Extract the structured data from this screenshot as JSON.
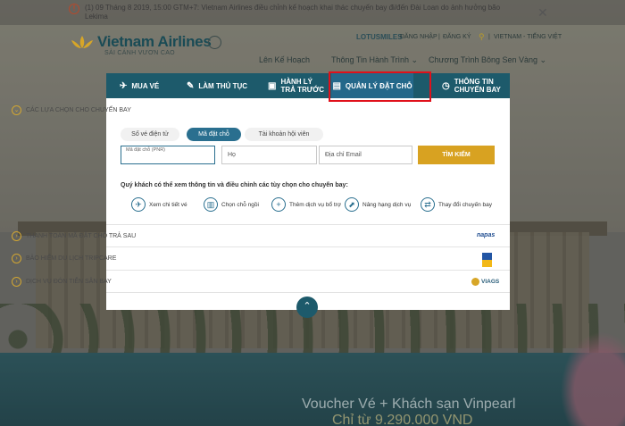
{
  "notice": {
    "text": "(1) 09 Tháng 8 2019, 15:00 GTM+7: Vietnam Airlines điều chỉnh kế hoạch khai thác chuyến bay đi/đến Đài Loan do ảnh hưởng bão Lekima",
    "close": "✕"
  },
  "header": {
    "logo": "Vietnam Airlines",
    "tagline": "SẢI CÁNH VƯƠN CAO",
    "lotusmiles": "LOTUSMILES",
    "login": "ĐĂNG NHẬP",
    "separator": "|",
    "register": "ĐĂNG KÝ",
    "search_icon": "⚲",
    "language": "VIETNAM - TIẾNG VIỆT",
    "nav": [
      "Lên Kế Hoạch",
      "Thông Tin Hành Trình ⌄",
      "Chương Trình Bông Sen Vàng ⌄"
    ]
  },
  "tabs": [
    {
      "icon": "✈",
      "icon_name": "plane-icon",
      "label": "MUA VÉ"
    },
    {
      "icon": "✎",
      "icon_name": "ticket-icon",
      "label": "LÀM THỦ TỤC"
    },
    {
      "icon": "▣",
      "icon_name": "luggage-icon",
      "label_1": "HÀNH LÝ",
      "label_2": "TRẢ TRƯỚC"
    },
    {
      "icon": "▤",
      "icon_name": "booking-icon",
      "label": "QUẢN LÝ ĐẶT CHỖ"
    },
    {
      "icon": "◷",
      "icon_name": "clock-icon",
      "label_1": "THÔNG TIN",
      "label_2": "CHUYẾN BAY"
    }
  ],
  "options_section": {
    "title": "CÁC LỰA CHỌN CHO CHUYẾN BAY",
    "subtabs": [
      "Số vé điện tử",
      "Mã đặt chỗ",
      "Tài khoản hội viên"
    ],
    "pnr_label": "Mã đặt chỗ (PNR)",
    "surname_placeholder": "Họ",
    "email_placeholder": "Địa chỉ Email",
    "search_button": "TÌM KIẾM",
    "info_text": "Quý khách có thể xem thông tin và điều chỉnh các tùy chọn cho chuyến bay:",
    "actions": [
      {
        "icon": "✈",
        "label": "Xem chi tiết vé"
      },
      {
        "icon": "▥",
        "label": "Chọn chỗ ngồi"
      },
      {
        "icon": "+",
        "label": "Thêm dịch vụ bổ trợ"
      },
      {
        "icon": "⬈",
        "label": "Nâng hạng dịch vụ"
      },
      {
        "icon": "⇄",
        "label": "Thay đổi chuyến bay"
      }
    ]
  },
  "sections": [
    {
      "title": "THANH TOÁN MÃ ĐẶT CHỖ TRẢ SAU",
      "partner": "napas"
    },
    {
      "title": "BẢO HIỂM DU LỊCH TRIPCARE",
      "partner": ""
    },
    {
      "title": "DỊCH VỤ ĐÓN TIỄN SÂN BAY",
      "partner": "VIAGS"
    }
  ],
  "collapse_icon": "⌃",
  "promo": {
    "line1": "Voucher Vé + Khách sạn Vinpearl",
    "line2": "Chỉ từ 9.290.000 VND"
  },
  "colors": {
    "tab_bar": "#1d5a6b",
    "active_subtab": "#2a6f8f",
    "search_button": "#d8a221",
    "highlight": "#e0111b"
  }
}
